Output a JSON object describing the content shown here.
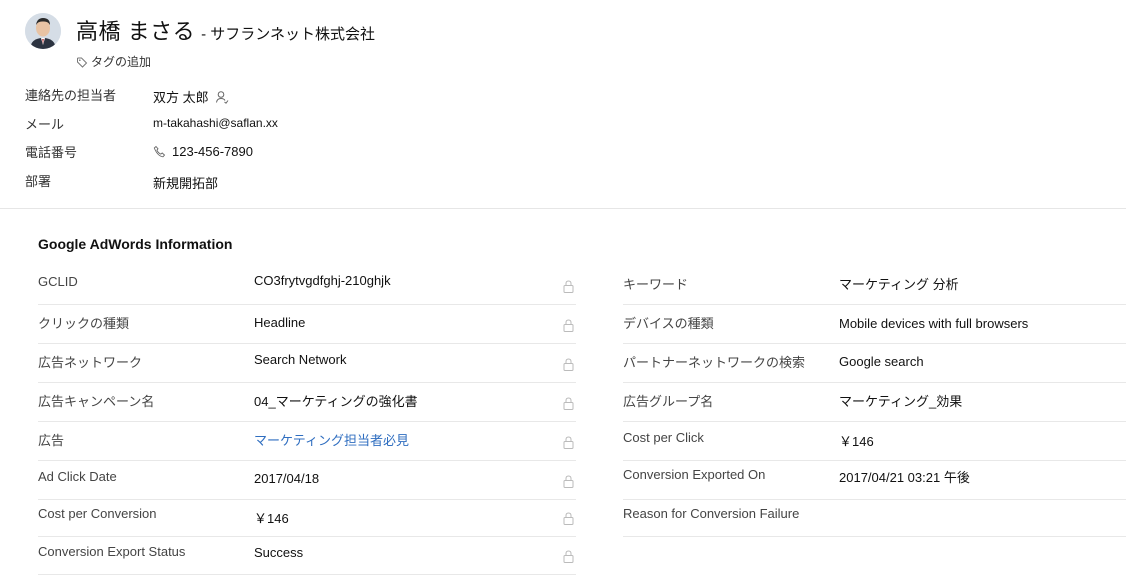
{
  "contact": {
    "name": "高橋 まさる",
    "company": "- サフランネット株式会社",
    "add_tag": "タグの追加"
  },
  "details": [
    {
      "label": "連絡先の担当者",
      "value": "双方 太郎",
      "icon": "user-icon"
    },
    {
      "label": "メール",
      "value": "m-takahashi@saflan.xx",
      "icon": ""
    },
    {
      "label": "電話番号",
      "value": "123-456-7890",
      "icon": "phone-icon"
    },
    {
      "label": "部署",
      "value": "新規開拓部",
      "icon": ""
    }
  ],
  "adwords": {
    "title": "Google AdWords Information",
    "left": [
      {
        "label": "GCLID",
        "value": "CO3frytvgdfghj-210ghjk",
        "locked": true
      },
      {
        "label": "クリックの種類",
        "value": "Headline",
        "locked": true
      },
      {
        "label": "広告ネットワーク",
        "value": "Search Network",
        "locked": true
      },
      {
        "label": "広告キャンペーン名",
        "value": "04_マーケティングの強化書",
        "locked": true
      },
      {
        "label": "広告",
        "value": "マーケティング担当者必見",
        "locked": true,
        "link": true
      },
      {
        "label": "Ad Click Date",
        "value": "2017/04/18",
        "locked": true
      },
      {
        "label": "Cost per Conversion",
        "value": "￥146",
        "locked": true
      },
      {
        "label": "Conversion Export Status",
        "value": "Success",
        "locked": true
      }
    ],
    "right": [
      {
        "label": "キーワード",
        "value": "マーケティング 分析"
      },
      {
        "label": "デバイスの種類",
        "value": "Mobile devices with full browsers"
      },
      {
        "label": "パートナーネットワークの検索",
        "value": "Google search"
      },
      {
        "label": "広告グループ名",
        "value": "マーケティング_効果"
      },
      {
        "label": "Cost per Click",
        "value": "￥146"
      },
      {
        "label": "Conversion Exported On",
        "value": "2017/04/21 03:21 午後"
      },
      {
        "label": "Reason for Conversion Failure",
        "value": ""
      }
    ]
  },
  "colors": {
    "link": "#2f6ec0",
    "divider": "#e8e8e8"
  }
}
